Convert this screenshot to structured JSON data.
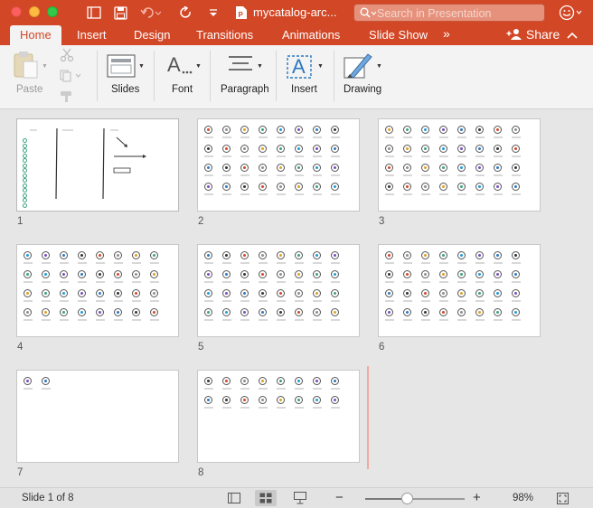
{
  "titlebar": {
    "doc_title": "mycatalog-arc...",
    "search_placeholder": "Search in Presentation"
  },
  "tabs": [
    {
      "label": "Home",
      "active": true
    },
    {
      "label": "Insert"
    },
    {
      "label": "Design"
    },
    {
      "label": "Transitions"
    },
    {
      "label": "Animations"
    },
    {
      "label": "Slide Show"
    }
  ],
  "tabs_overflow": "»",
  "share_label": "Share",
  "ribbon": {
    "paste": "Paste",
    "slides": "Slides",
    "font": "Font",
    "paragraph": "Paragraph",
    "insert": "Insert",
    "drawing": "Drawing"
  },
  "slides": [
    {
      "number": "1"
    },
    {
      "number": "2"
    },
    {
      "number": "3"
    },
    {
      "number": "4"
    },
    {
      "number": "5"
    },
    {
      "number": "6"
    },
    {
      "number": "7"
    },
    {
      "number": "8"
    }
  ],
  "status": {
    "slide_position": "Slide 1 of 8",
    "zoom": "98%",
    "zoom_level": 0.42
  },
  "colors": {
    "accent": "#d24726",
    "selected_view": "#c9c9c9"
  }
}
